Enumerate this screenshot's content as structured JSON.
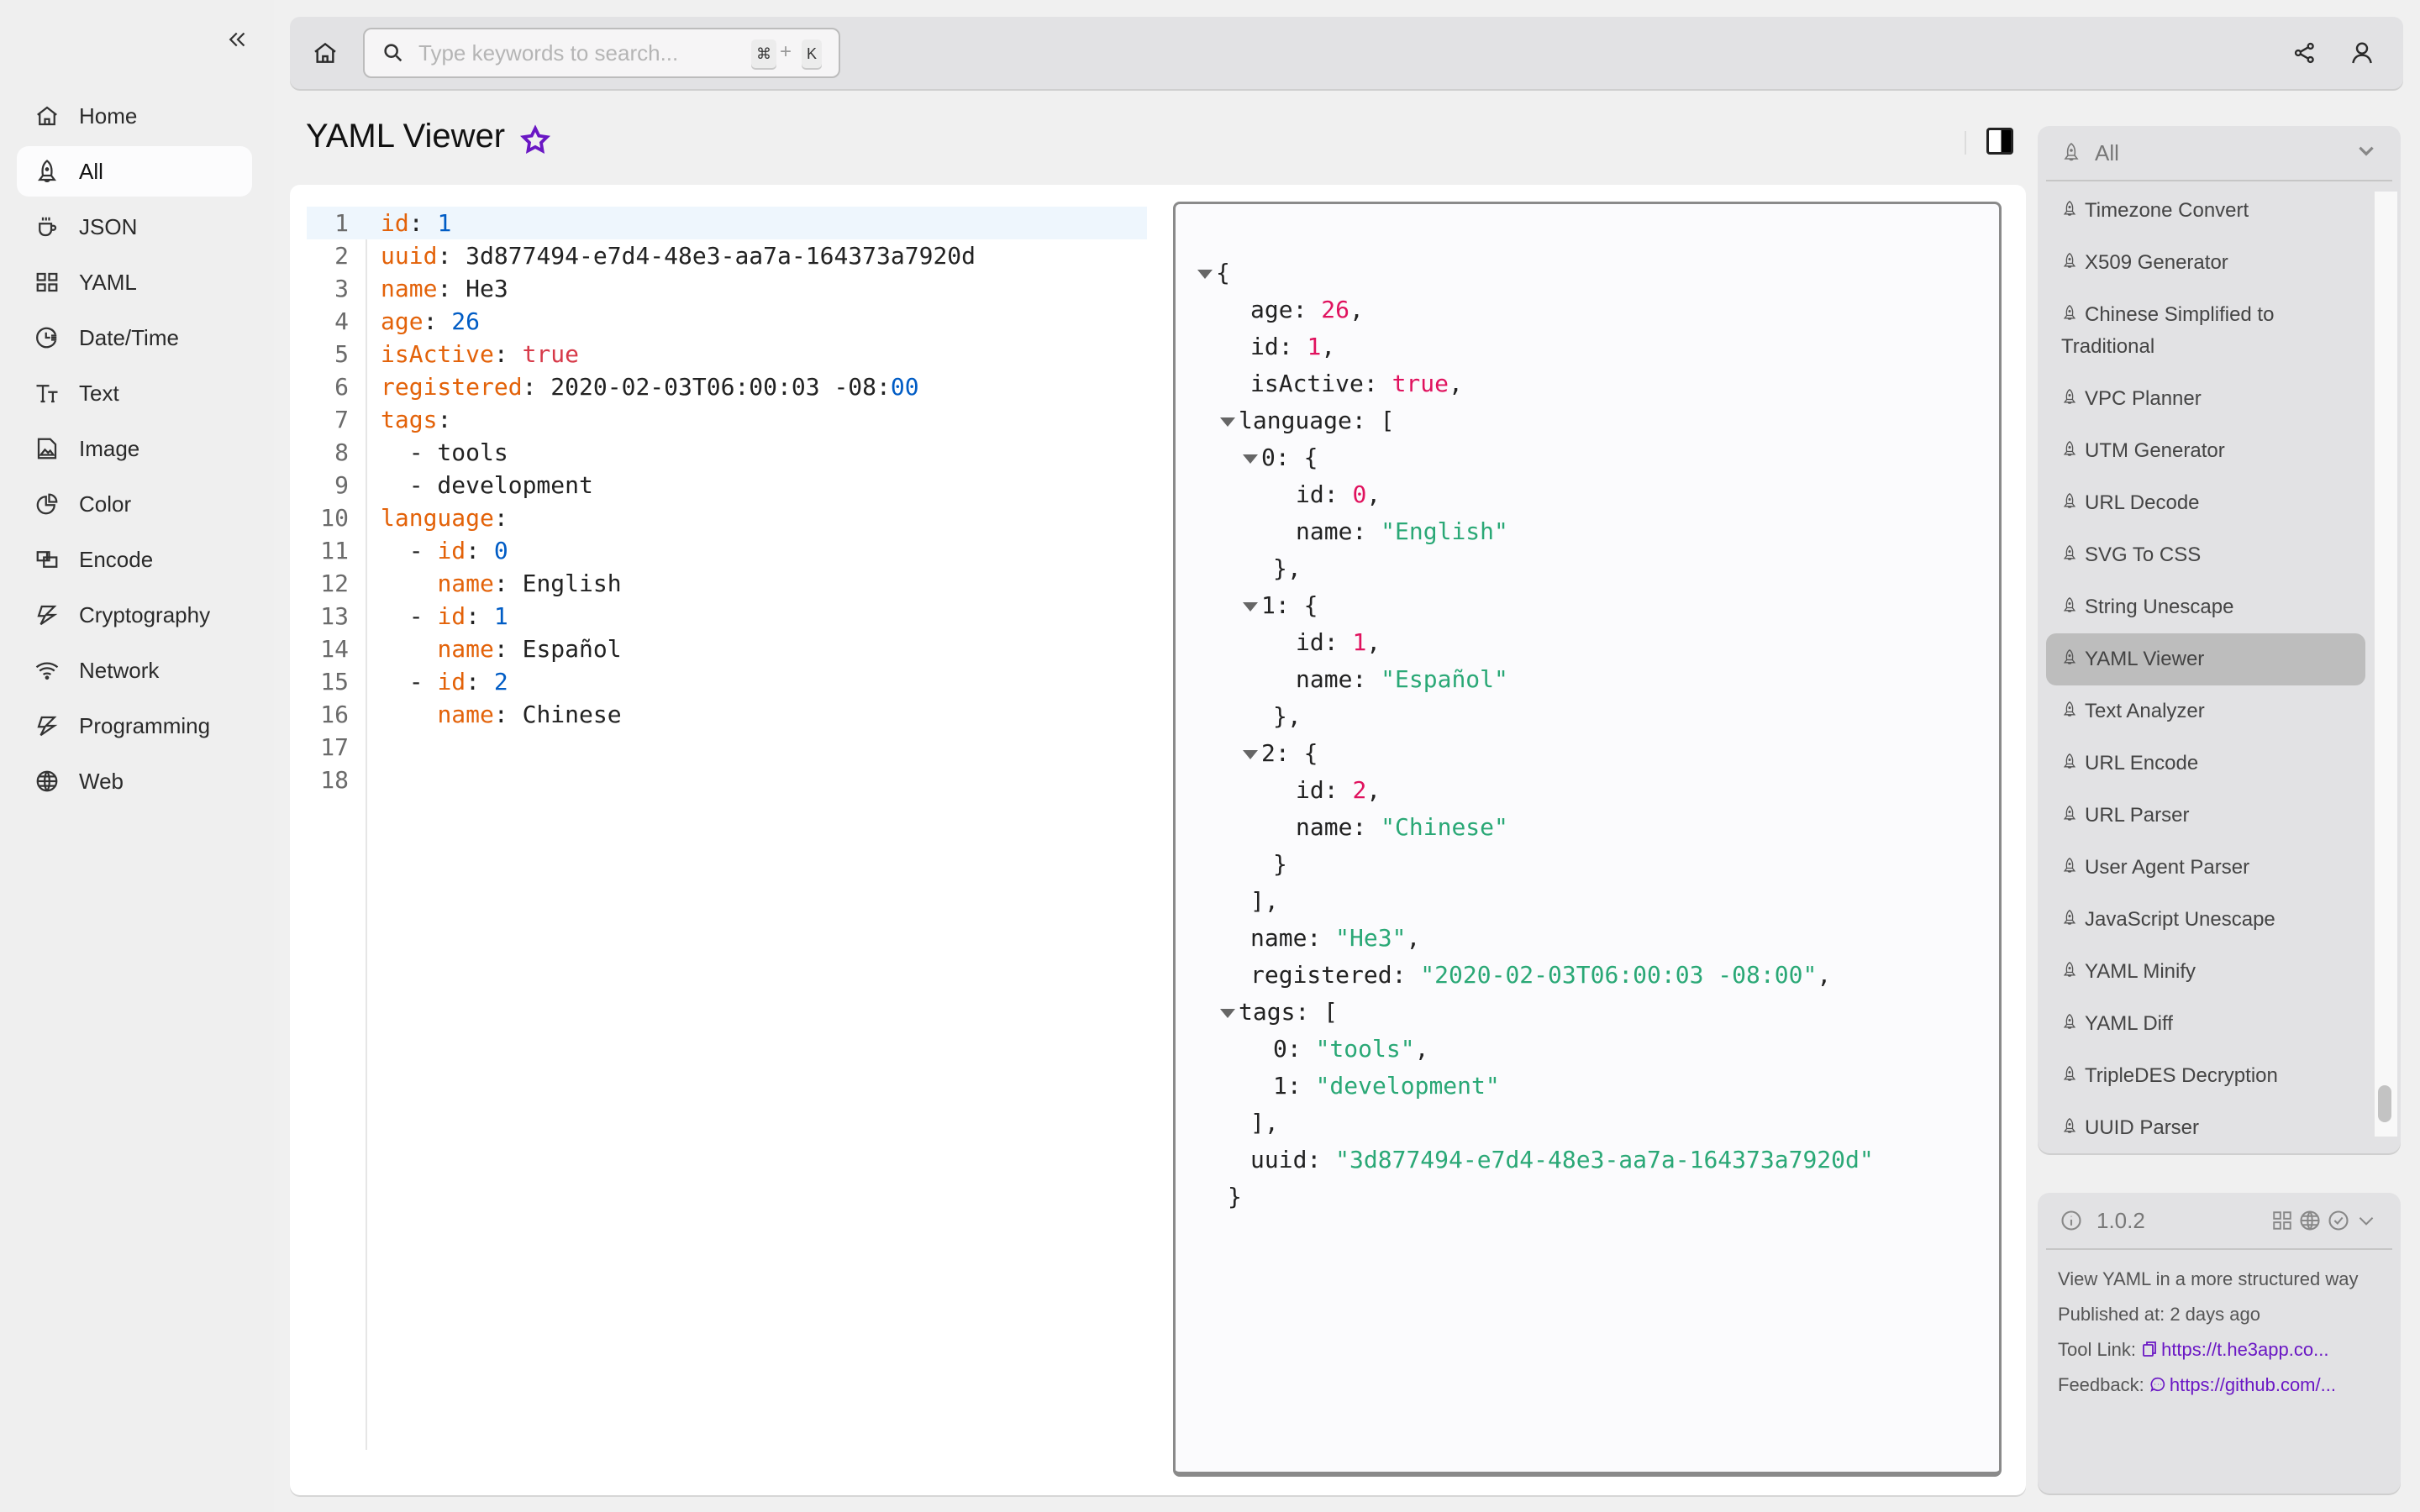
{
  "sidebar": {
    "collapse_icon": "chevrons-left-icon",
    "items": [
      {
        "label": "Home",
        "icon": "home-icon"
      },
      {
        "label": "All",
        "icon": "rocket-icon",
        "active": true
      },
      {
        "label": "JSON",
        "icon": "cup-icon"
      },
      {
        "label": "YAML",
        "icon": "grid-icon"
      },
      {
        "label": "Date/Time",
        "icon": "clock-icon"
      },
      {
        "label": "Text",
        "icon": "text-size-icon"
      },
      {
        "label": "Image",
        "icon": "image-icon"
      },
      {
        "label": "Color",
        "icon": "pie-icon"
      },
      {
        "label": "Encode",
        "icon": "encode-icon"
      },
      {
        "label": "Cryptography",
        "icon": "bolt-icon"
      },
      {
        "label": "Network",
        "icon": "wifi-icon"
      },
      {
        "label": "Programming",
        "icon": "bolt-icon"
      },
      {
        "label": "Web",
        "icon": "globe-icon"
      }
    ]
  },
  "topbar": {
    "search_placeholder": "Type keywords to search...",
    "search_value": "",
    "shortcut_cmd": "⌘",
    "shortcut_plus": "+",
    "shortcut_key": "K"
  },
  "page": {
    "title": "YAML Viewer",
    "favorite_icon": "star-icon"
  },
  "editor": {
    "current_line": 1,
    "lines": [
      [
        {
          "t": "k",
          "v": "id"
        },
        {
          "t": "p",
          "v": ": "
        },
        {
          "t": "n",
          "v": "1"
        }
      ],
      [
        {
          "t": "k",
          "v": "uuid"
        },
        {
          "t": "p",
          "v": ": 3d877494-e7d4-48e3-aa7a-164373a7920d"
        }
      ],
      [
        {
          "t": "k",
          "v": "name"
        },
        {
          "t": "p",
          "v": ": He3"
        }
      ],
      [
        {
          "t": "k",
          "v": "age"
        },
        {
          "t": "p",
          "v": ": "
        },
        {
          "t": "n",
          "v": "26"
        }
      ],
      [
        {
          "t": "k",
          "v": "isActive"
        },
        {
          "t": "p",
          "v": ": "
        },
        {
          "t": "b",
          "v": "true"
        }
      ],
      [
        {
          "t": "k",
          "v": "registered"
        },
        {
          "t": "p",
          "v": ": 2020-02-03T06:00:03 -08:"
        },
        {
          "t": "n",
          "v": "00"
        }
      ],
      [
        {
          "t": "k",
          "v": "tags"
        },
        {
          "t": "p",
          "v": ":"
        }
      ],
      [
        {
          "t": "p",
          "v": "  - tools"
        }
      ],
      [
        {
          "t": "p",
          "v": "  - development"
        }
      ],
      [
        {
          "t": "k",
          "v": "language"
        },
        {
          "t": "p",
          "v": ":"
        }
      ],
      [
        {
          "t": "p",
          "v": "  - "
        },
        {
          "t": "k",
          "v": "id"
        },
        {
          "t": "p",
          "v": ": "
        },
        {
          "t": "n",
          "v": "0"
        }
      ],
      [
        {
          "t": "p",
          "v": "    "
        },
        {
          "t": "k",
          "v": "name"
        },
        {
          "t": "p",
          "v": ": English"
        }
      ],
      [
        {
          "t": "p",
          "v": "  - "
        },
        {
          "t": "k",
          "v": "id"
        },
        {
          "t": "p",
          "v": ": "
        },
        {
          "t": "n",
          "v": "1"
        }
      ],
      [
        {
          "t": "p",
          "v": "    "
        },
        {
          "t": "k",
          "v": "name"
        },
        {
          "t": "p",
          "v": ": Español"
        }
      ],
      [
        {
          "t": "p",
          "v": "  - "
        },
        {
          "t": "k",
          "v": "id"
        },
        {
          "t": "p",
          "v": ": "
        },
        {
          "t": "n",
          "v": "2"
        }
      ],
      [
        {
          "t": "p",
          "v": "    "
        },
        {
          "t": "k",
          "v": "name"
        },
        {
          "t": "p",
          "v": ": Chinese"
        }
      ],
      [],
      []
    ]
  },
  "json_view": {
    "lines": [
      {
        "indent": 0,
        "toggle": true,
        "parts": [
          {
            "t": "p",
            "v": "{"
          }
        ]
      },
      {
        "indent": 1,
        "parts": [
          {
            "t": "k",
            "v": "age: "
          },
          {
            "t": "n",
            "v": "26"
          },
          {
            "t": "p",
            "v": ","
          }
        ]
      },
      {
        "indent": 1,
        "parts": [
          {
            "t": "k",
            "v": "id: "
          },
          {
            "t": "n",
            "v": "1"
          },
          {
            "t": "p",
            "v": ","
          }
        ]
      },
      {
        "indent": 1,
        "parts": [
          {
            "t": "k",
            "v": "isActive: "
          },
          {
            "t": "n",
            "v": "true"
          },
          {
            "t": "p",
            "v": ","
          }
        ]
      },
      {
        "indent": 1,
        "toggle": true,
        "parts": [
          {
            "t": "k",
            "v": "language: "
          },
          {
            "t": "p",
            "v": "["
          }
        ]
      },
      {
        "indent": 2,
        "toggle": true,
        "parts": [
          {
            "t": "k",
            "v": "0: "
          },
          {
            "t": "p",
            "v": "{"
          }
        ]
      },
      {
        "indent": 3,
        "parts": [
          {
            "t": "k",
            "v": "id: "
          },
          {
            "t": "n",
            "v": "0"
          },
          {
            "t": "p",
            "v": ","
          }
        ]
      },
      {
        "indent": 3,
        "parts": [
          {
            "t": "k",
            "v": "name: "
          },
          {
            "t": "s",
            "v": "\"English\""
          }
        ]
      },
      {
        "indent": 2,
        "parts": [
          {
            "t": "p",
            "v": "},"
          }
        ]
      },
      {
        "indent": 2,
        "toggle": true,
        "parts": [
          {
            "t": "k",
            "v": "1: "
          },
          {
            "t": "p",
            "v": "{"
          }
        ]
      },
      {
        "indent": 3,
        "parts": [
          {
            "t": "k",
            "v": "id: "
          },
          {
            "t": "n",
            "v": "1"
          },
          {
            "t": "p",
            "v": ","
          }
        ]
      },
      {
        "indent": 3,
        "parts": [
          {
            "t": "k",
            "v": "name: "
          },
          {
            "t": "s",
            "v": "\"Español\""
          }
        ]
      },
      {
        "indent": 2,
        "parts": [
          {
            "t": "p",
            "v": "},"
          }
        ]
      },
      {
        "indent": 2,
        "toggle": true,
        "parts": [
          {
            "t": "k",
            "v": "2: "
          },
          {
            "t": "p",
            "v": "{"
          }
        ]
      },
      {
        "indent": 3,
        "parts": [
          {
            "t": "k",
            "v": "id: "
          },
          {
            "t": "n",
            "v": "2"
          },
          {
            "t": "p",
            "v": ","
          }
        ]
      },
      {
        "indent": 3,
        "parts": [
          {
            "t": "k",
            "v": "name: "
          },
          {
            "t": "s",
            "v": "\"Chinese\""
          }
        ]
      },
      {
        "indent": 2,
        "parts": [
          {
            "t": "p",
            "v": "}"
          }
        ]
      },
      {
        "indent": 1,
        "parts": [
          {
            "t": "p",
            "v": "],"
          }
        ]
      },
      {
        "indent": 1,
        "parts": [
          {
            "t": "k",
            "v": "name: "
          },
          {
            "t": "s",
            "v": "\"He3\""
          },
          {
            "t": "p",
            "v": ","
          }
        ]
      },
      {
        "indent": 1,
        "parts": [
          {
            "t": "k",
            "v": "registered: "
          },
          {
            "t": "s",
            "v": "\"2020-02-03T06:00:03 -08:00\""
          },
          {
            "t": "p",
            "v": ","
          }
        ]
      },
      {
        "indent": 1,
        "toggle": true,
        "parts": [
          {
            "t": "k",
            "v": "tags: "
          },
          {
            "t": "p",
            "v": "["
          }
        ]
      },
      {
        "indent": 2,
        "parts": [
          {
            "t": "k",
            "v": "0: "
          },
          {
            "t": "s",
            "v": "\"tools\""
          },
          {
            "t": "p",
            "v": ","
          }
        ]
      },
      {
        "indent": 2,
        "parts": [
          {
            "t": "k",
            "v": "1: "
          },
          {
            "t": "s",
            "v": "\"development\""
          }
        ]
      },
      {
        "indent": 1,
        "parts": [
          {
            "t": "p",
            "v": "],"
          }
        ]
      },
      {
        "indent": 1,
        "parts": [
          {
            "t": "k",
            "v": "uuid: "
          },
          {
            "t": "s",
            "v": "\"3d877494-e7d4-48e3-aa7a-164373a7920d\""
          }
        ]
      },
      {
        "indent": 0,
        "parts": [
          {
            "t": "p",
            "v": "}"
          }
        ]
      }
    ]
  },
  "tool_list": {
    "category": "All",
    "items": [
      "Timezone Convert",
      "X509 Generator",
      "Chinese Simplified to Traditional",
      "VPC Planner",
      "UTM Generator",
      "URL Decode",
      "SVG To CSS",
      "String Unescape",
      "YAML Viewer",
      "Text Analyzer",
      "URL Encode",
      "URL Parser",
      "User Agent Parser",
      "JavaScript Unescape",
      "YAML Minify",
      "YAML Diff",
      "TripleDES Decryption",
      "UUID Parser"
    ],
    "active": "YAML Viewer"
  },
  "info": {
    "version": "1.0.2",
    "description": "View YAML in a more structured way",
    "published_label": "Published at:",
    "published_value": "2 days ago",
    "tool_link_label": "Tool Link:",
    "tool_link": "https://t.he3app.co...",
    "feedback_label": "Feedback:",
    "feedback_link": "https://github.com/..."
  },
  "colors": {
    "accent": "#6a17c4",
    "yaml_key": "#e36209",
    "yaml_number": "#005cc5",
    "yaml_bool": "#d73a49",
    "json_number": "#e0125e",
    "json_string": "#2aa876"
  }
}
